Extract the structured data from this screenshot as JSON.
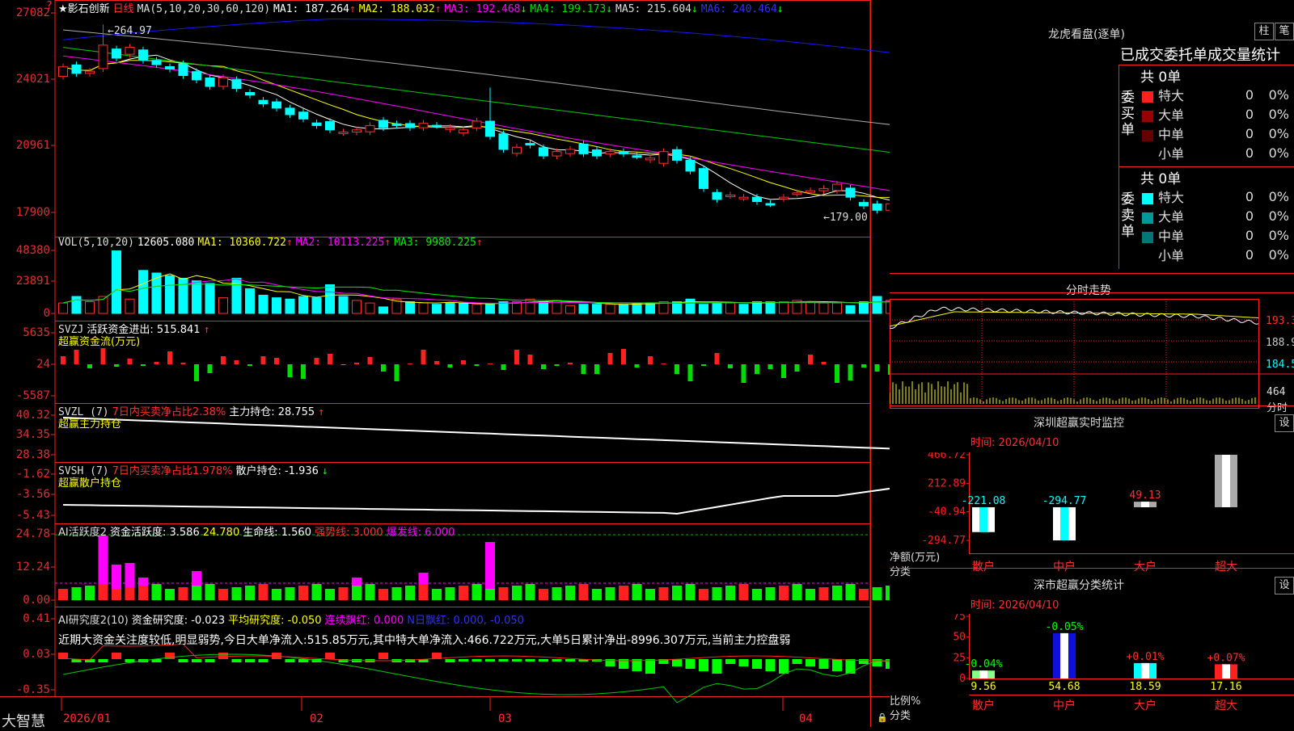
{
  "app": {
    "title_prefix": "★影石创新",
    "period": "日线",
    "watermark": "大智慧"
  },
  "colors": {
    "up": "#ff3030",
    "down": "#00ffff",
    "grid": "#ff2020",
    "ma1": "#ffffff",
    "ma2": "#ffff00",
    "ma3": "#ff00ff",
    "ma4": "#00cc00",
    "ma5": "#aaaaaa",
    "ma6": "#1515ff"
  },
  "price_panel": {
    "ma_label": "MA(5,10,20,30,60,120)",
    "ma": [
      {
        "text": "MA1: 187.264",
        "arrow": "↑",
        "color": "#ffffff"
      },
      {
        "text": "MA2: 188.032",
        "arrow": "↑",
        "color": "#ffff00"
      },
      {
        "text": "MA3: 192.468",
        "arrow": "↓",
        "color": "#ff00ff"
      },
      {
        "text": "MA4: 199.173",
        "arrow": "↓",
        "color": "#00dd00"
      },
      {
        "text": "MA5: 215.604",
        "arrow": "↓",
        "color": "#dddddd"
      },
      {
        "text": "MA6: 240.464",
        "arrow": "↓",
        "color": "#3030ff"
      }
    ],
    "y_labels": [
      "27082",
      "24021",
      "20961",
      "17900"
    ],
    "high_label": "264.97",
    "low_label": "179.00"
  },
  "vol_panel": {
    "label": "VOL(5,10,20)",
    "value": "12605.080",
    "ma": [
      {
        "text": "MA1: 10360.722",
        "arrow": "↑",
        "color": "#ffff00"
      },
      {
        "text": "MA2: 10113.225",
        "arrow": "↑",
        "color": "#ff00ff"
      },
      {
        "text": "MA3: 9980.225",
        "arrow": "↑",
        "color": "#00ee00"
      }
    ],
    "y_labels": [
      "48380",
      "23891",
      "0"
    ]
  },
  "svzj_panel": {
    "label": "SVZJ",
    "desc": "活跃资金进出: 515.841",
    "arrow": "↑",
    "sub": "超赢资金流(万元)",
    "y_labels": [
      "5635",
      "24",
      "-5587"
    ]
  },
  "svzl_panel": {
    "label": "SVZL (7)",
    "desc_red": "7日内买卖净占比2.38%",
    "desc": "主力持仓: 28.755",
    "arrow": "↑",
    "sub": "超赢主力持仓",
    "y_labels": [
      "40.32",
      "34.35",
      "28.38"
    ]
  },
  "svsh_panel": {
    "label": "SVSH (7)",
    "desc_red": "7日内买卖净占比1.978%",
    "desc": "散户持仓: -1.936",
    "arrow": "↓",
    "sub": "超赢散户持仓",
    "y_labels": [
      "-1.62",
      "-3.56",
      "-5.43"
    ]
  },
  "ai_active_panel": {
    "label": "AI活跃度2",
    "desc": "资金活跃度: 3.586",
    "v2": "24.780",
    "v3": "生命线: 1.560",
    "v4": "强势线: 3.000",
    "v5": "爆发线: 6.000",
    "y_labels": [
      "24.78",
      "12.24",
      "0.00"
    ]
  },
  "ai_research_panel": {
    "label": "AI研究度2(10)",
    "desc": "资金研究度: -0.023",
    "avg": "平均研究度: -0.050",
    "lianxu": "连续飘红: 0.000",
    "nday": "N日飘红: 0.000, -0.050",
    "comment": "近期大资金关注度较低,明显弱势,今日大单净流入:515.85万元,其中特大单净流入:466.722万元,大单5日累计净出-8996.307万元,当前主力控盘弱",
    "y_labels": [
      "0.41",
      "0.03",
      "-0.35"
    ]
  },
  "x_axis": {
    "labels": [
      "2026/01",
      "02",
      "03",
      "04"
    ]
  },
  "orderbook": {
    "title": "龙虎看盘(逐单)",
    "btn1": "柱",
    "btn2": "笔",
    "header": "已成交委托单成交量统计",
    "buy_label": "委买单",
    "sell_label": "委卖单",
    "buy_total": "共 0单",
    "sell_total": "共 0单",
    "buy_rows": [
      {
        "name": "特大",
        "count": "0",
        "pct": "0%",
        "color": "#ff2020"
      },
      {
        "name": "大单",
        "count": "0",
        "pct": "0%",
        "color": "#990000"
      },
      {
        "name": "中单",
        "count": "0",
        "pct": "0%",
        "color": "#660000"
      },
      {
        "name": "小单",
        "count": "0",
        "pct": "0%",
        "color": ""
      }
    ],
    "sell_rows": [
      {
        "name": "特大",
        "count": "0",
        "pct": "0%",
        "color": "#00ffff"
      },
      {
        "name": "大单",
        "count": "0",
        "pct": "0%",
        "color": "#009999"
      },
      {
        "name": "中单",
        "count": "0",
        "pct": "0%",
        "color": "#007777"
      },
      {
        "name": "小单",
        "count": "0",
        "pct": "0%",
        "color": ""
      }
    ]
  },
  "intraday": {
    "title": "分时走势",
    "y_labels": [
      "193.3",
      "188.9",
      "184.5"
    ],
    "vol_label": "464",
    "vol_unit": "分时"
  },
  "monitor": {
    "title": "深圳超赢实时监控",
    "btn": "设",
    "time": "时间: 2026/04/10",
    "unit": "净额(万元)",
    "axis": "分类",
    "y_labels": [
      "466.72",
      "212.89",
      "-40.94",
      "-294.77"
    ]
  },
  "classstat": {
    "title": "深市超赢分类统计",
    "btn": "设",
    "time": "时间: 2026/04/10",
    "unit": "比例%",
    "axis": "分类",
    "y_labels": [
      "75",
      "50",
      "25",
      "0"
    ]
  },
  "chart_data": [
    {
      "type": "bar",
      "title": "深圳超赢实时监控",
      "categories": [
        "散户",
        "中户",
        "大户",
        "超大"
      ],
      "values": [
        -221.08,
        -294.77,
        49.13,
        466.72
      ],
      "ylim": [
        -294.77,
        466.72
      ],
      "xlabel": "分类",
      "ylabel": "净额(万元)"
    },
    {
      "type": "bar",
      "title": "深市超赢分类统计",
      "categories": [
        "散户",
        "中户",
        "大户",
        "超大"
      ],
      "series": [
        {
          "values": [
            9.56,
            54.68,
            18.59,
            17.16
          ]
        },
        {
          "values": [
            -0.04,
            -0.05,
            0.01,
            0.07
          ]
        }
      ],
      "ylim": [
        0,
        75
      ],
      "xlabel": "分类",
      "ylabel": "比例%"
    },
    {
      "type": "bar",
      "title": "VOL(5,10,20)",
      "values": [
        8000,
        13000,
        9000,
        13000,
        48000,
        11000,
        33000,
        31000,
        29000,
        27000,
        25000,
        23000,
        12000,
        27000,
        19000,
        14000,
        12000,
        11000,
        13000,
        12000,
        22000,
        13000,
        10000,
        8000,
        5000,
        11000,
        9000,
        8000,
        7000,
        8000,
        8000,
        7000,
        7000,
        9000,
        9000,
        11000,
        9000,
        10000,
        6000,
        7000,
        7000,
        7000,
        7000,
        8000,
        8000,
        9000,
        9000,
        11000,
        7000,
        8000,
        8000,
        7000,
        9000,
        9000,
        9000,
        10000,
        9000,
        8000,
        8000,
        6000,
        9000,
        13000,
        10000,
        9000,
        10000,
        9000,
        8000,
        13000,
        10000,
        9000
      ],
      "ylim": [
        0,
        48380
      ],
      "xlabel": "",
      "ylabel": ""
    }
  ]
}
